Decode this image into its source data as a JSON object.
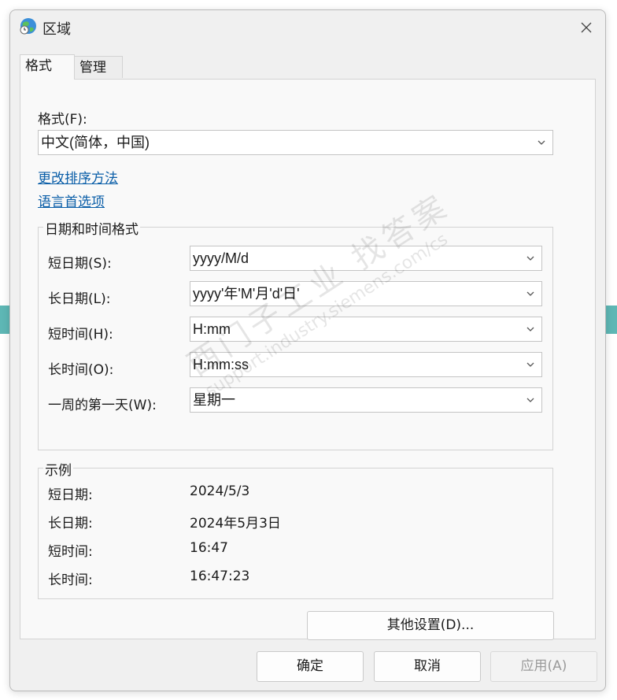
{
  "window": {
    "title": "区域",
    "tabs": [
      {
        "label": "格式"
      },
      {
        "label": "管理"
      }
    ]
  },
  "format": {
    "label": "格式(F):",
    "value": "中文(简体，中国)",
    "links": {
      "change_sort": "更改排序方法",
      "language_prefs": "语言首选项"
    }
  },
  "datetime": {
    "legend": "日期和时间格式",
    "rows": [
      {
        "label": "短日期(S):",
        "value": "yyyy/M/d"
      },
      {
        "label": "长日期(L):",
        "value": "yyyy'年'M'月'd'日'"
      },
      {
        "label": "短时间(H):",
        "value": "H:mm"
      },
      {
        "label": "长时间(O):",
        "value": "H:mm:ss"
      },
      {
        "label": "一周的第一天(W):",
        "value": "星期一"
      }
    ]
  },
  "examples": {
    "legend": "示例",
    "rows": [
      {
        "label": "短日期:",
        "value": "2024/5/3"
      },
      {
        "label": "长日期:",
        "value": "2024年5月3日"
      },
      {
        "label": "短时间:",
        "value": "16:47"
      },
      {
        "label": "长时间:",
        "value": "16:47:23"
      }
    ]
  },
  "buttons": {
    "other_settings": "其他设置(D)...",
    "ok": "确定",
    "cancel": "取消",
    "apply": "应用(A)"
  },
  "watermark": {
    "line1": "西门子工业 找答案",
    "line2": "support.industry.siemens.com/cs"
  },
  "colors": {
    "link": "#0a5ea8",
    "accent_background_strip": "#5eb7b5"
  }
}
